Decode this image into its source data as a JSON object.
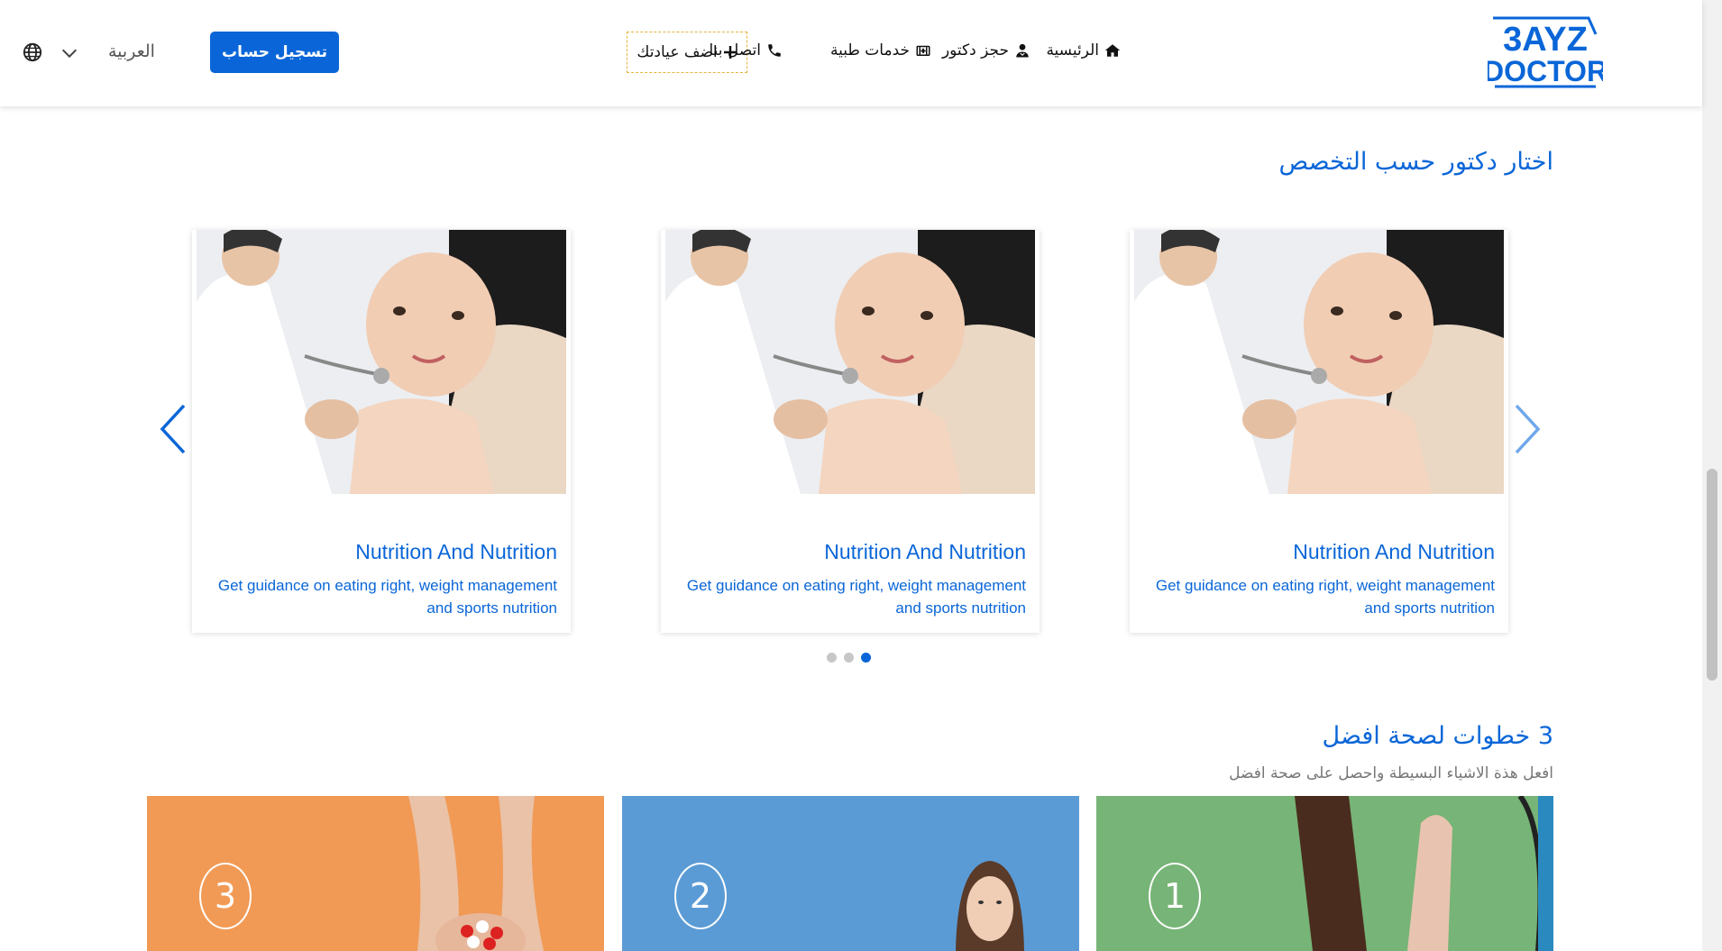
{
  "header": {
    "language": "العربية",
    "register_button": "تسجيل حساب",
    "add_clinic": "اضف عيادتك",
    "nav": {
      "contact": "اتصل بنا",
      "medical_services": "خدمات طبية",
      "book_doctor": "حجز دكتور",
      "home": "الرئيسية"
    },
    "logo": {
      "line1": "3AYZ",
      "line2": "DOCTOR"
    }
  },
  "specialties": {
    "title": "اختار دكتور حسب التخصص",
    "cards": [
      {
        "title": "Nutrition And Nutrition",
        "desc": "Get guidance on eating right, weight management and sports nutrition"
      },
      {
        "title": "Nutrition And Nutrition",
        "desc": "Get guidance on eating right, weight management and sports nutrition"
      },
      {
        "title": "Nutrition And Nutrition",
        "desc": "Get guidance on eating right, weight management and sports nutrition"
      }
    ],
    "dots_count": 3,
    "active_dot": 3
  },
  "steps": {
    "title": "3 خطوات لصحة افضل",
    "subtitle": "افعل هذة الاشياء البسيطة واحصل على صحة افضل",
    "items": [
      {
        "number": "3",
        "color": "#f19a55"
      },
      {
        "number": "2",
        "color": "#5b9bd5"
      },
      {
        "number": "1",
        "color": "#77b477"
      }
    ]
  },
  "colors": {
    "accent": "#0a66d8",
    "dashed_border": "#e6b53b"
  }
}
